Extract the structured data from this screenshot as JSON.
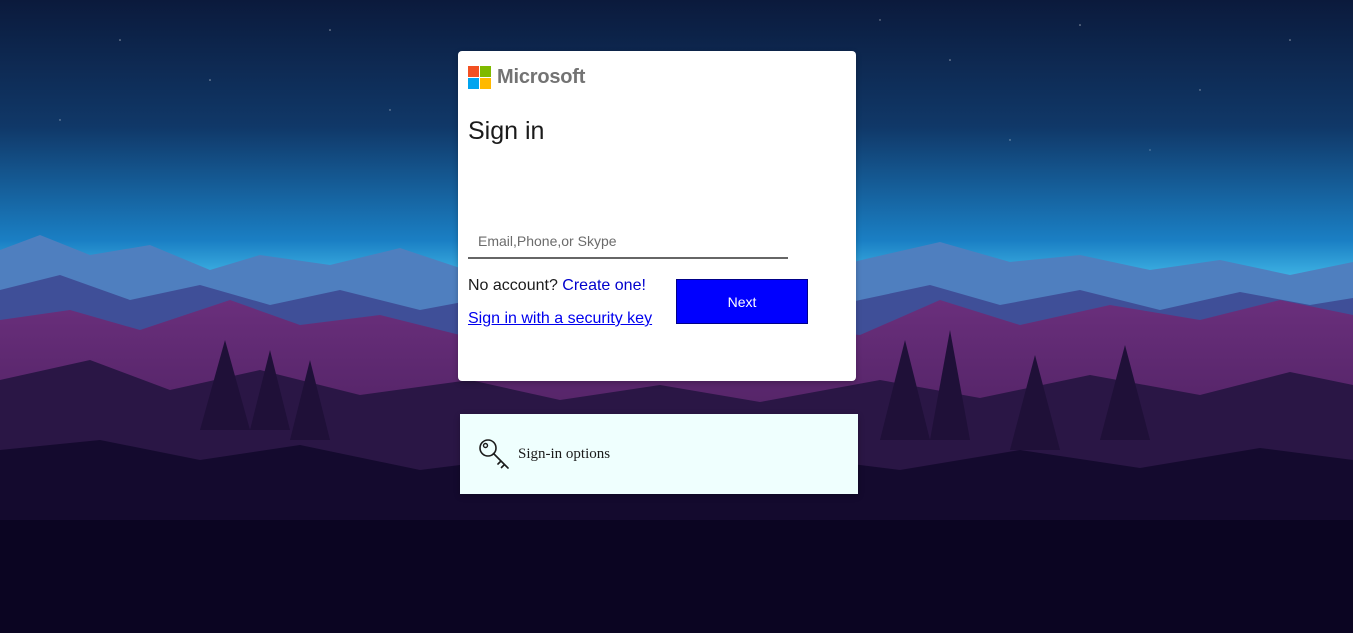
{
  "brand": {
    "name": "Microsoft",
    "logo_colors": [
      "#f25022",
      "#7fba00",
      "#00a4ef",
      "#ffb900"
    ]
  },
  "signin": {
    "title": "Sign in",
    "email_placeholder": "Email,Phone,or Skype",
    "email_value": "",
    "no_account_text": "No account?",
    "create_link": "Create one!",
    "security_key_link": "Sign in with a security key",
    "next_label": "Next"
  },
  "options": {
    "label": "Sign-in options",
    "icon": "key-icon"
  },
  "colors": {
    "next_button": "#0000ff",
    "options_panel": "#effffe",
    "link": "#0000ee"
  }
}
